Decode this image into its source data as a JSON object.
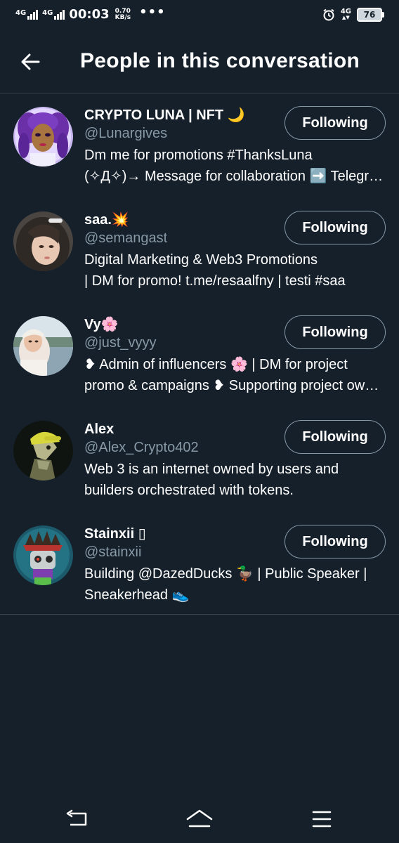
{
  "status_bar": {
    "network1": "4G",
    "network2": "4G",
    "time": "00:03",
    "speed_value": "0.70",
    "speed_unit": "KB/s",
    "more": "•••",
    "network_right": "4G",
    "network_right_sub": "▲▼",
    "battery": "76"
  },
  "header": {
    "title": "People in this conversation",
    "back_icon": "arrow-left-icon"
  },
  "people": [
    {
      "name": "CRYPTO LUNA | NFT 🌙",
      "handle": "@Lunargives",
      "bio_line1": "Dm me for promotions #ThanksLuna",
      "bio_line2": "(✧Д✧)→ Message for collaboration ➡️ Telegram",
      "button": "Following"
    },
    {
      "name": "saa.💥",
      "handle": "@semangast",
      "bio_line1": "Digital Marketing & Web3 Promotions",
      "bio_line2": "| DM for promo! t.me/resaalfny | testi #saa",
      "button": "Following"
    },
    {
      "name": "Vy🌸",
      "handle": "@just_vyyy",
      "bio_line1": "❥ Admin of influencers 🌸 | DM for project",
      "bio_line2": "promo & campaigns ❥ Supporting project owners",
      "button": "Following"
    },
    {
      "name": "Alex",
      "handle": "@Alex_Crypto402",
      "bio_line1": "Web 3 is an internet owned by users and",
      "bio_line2": "builders orchestrated with tokens.",
      "button": "Following"
    },
    {
      "name": "Stainxii ▯",
      "handle": "@stainxii",
      "bio_line1": "Building @DazedDucks 🦆 | Public Speaker |",
      "bio_line2": "Sneakerhead 👟",
      "button": "Following"
    }
  ],
  "nav_bar": {
    "back_icon": "nav-back-icon",
    "home_icon": "nav-home-icon",
    "menu_icon": "nav-menu-icon"
  },
  "colors": {
    "background": "#15202b",
    "secondary_text": "#8899a6",
    "divider": "#38444d"
  }
}
